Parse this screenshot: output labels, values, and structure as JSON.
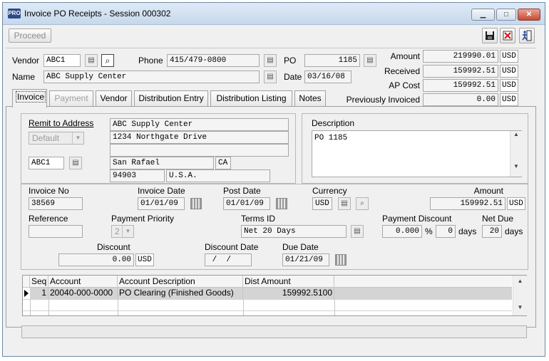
{
  "window": {
    "app_icon": "PRO",
    "title": "Invoice PO Receipts - Session 000302",
    "min_glyph": "▁",
    "max_glyph": "□",
    "close_glyph": "✕"
  },
  "toolbar": {
    "proceed_label": "Proceed",
    "save_icon": "save-icon",
    "delete_icon": "delete-icon",
    "exit_icon": "exit-icon"
  },
  "header": {
    "vendor_label": "Vendor",
    "vendor_value": "ABC1",
    "name_label": "Name",
    "name_value": "ABC Supply Center",
    "phone_label": "Phone",
    "phone_value": "415/479-0800",
    "po_label": "PO",
    "po_value": "1185",
    "date_label": "Date",
    "date_value": "03/16/08",
    "amount_label": "Amount",
    "amount_value": "219990.01",
    "received_label": "Received",
    "received_value": "159992.51",
    "ap_cost_label": "AP Cost",
    "ap_cost_value": "159992.51",
    "prev_invoiced_label": "Previously Invoiced",
    "prev_invoiced_value": "0.00",
    "currency": "USD"
  },
  "tabs": [
    {
      "label": "Invoice",
      "active": true,
      "disabled": false
    },
    {
      "label": "Payment",
      "active": false,
      "disabled": true
    },
    {
      "label": "Vendor",
      "active": false,
      "disabled": false
    },
    {
      "label": "Distribution Entry",
      "active": false,
      "disabled": false
    },
    {
      "label": "Distribution Listing",
      "active": false,
      "disabled": false
    },
    {
      "label": "Notes",
      "active": false,
      "disabled": false
    }
  ],
  "remit": {
    "label": "Remit to Address",
    "dropdown_value": "Default",
    "code": "ABC1",
    "line1": "ABC Supply Center",
    "line2": "1234 Northgate Drive",
    "line3": "",
    "city": "San Rafael",
    "state": "CA",
    "zip": "94903",
    "country": "U.S.A."
  },
  "description": {
    "label": "Description",
    "value": "PO 1185"
  },
  "invoice": {
    "invoice_no_label": "Invoice No",
    "invoice_no_value": "38569",
    "invoice_date_label": "Invoice Date",
    "invoice_date_value": "01/01/09",
    "post_date_label": "Post Date",
    "post_date_value": "01/01/09",
    "currency_label": "Currency",
    "currency_value": "USD",
    "amount_label": "Amount",
    "amount_value": "159992.51",
    "reference_label": "Reference",
    "reference_value": "",
    "payment_priority_label": "Payment Priority",
    "payment_priority_value": "2",
    "terms_label": "Terms ID",
    "terms_value": "Net 20 Days",
    "payment_discount_label": "Payment Discount",
    "payment_discount_value": "0.000",
    "pct": "%",
    "discount_days_value": "0",
    "days_label": "days",
    "net_due_label": "Net Due",
    "net_due_value": "20",
    "discount_label": "Discount",
    "discount_value": "0.00",
    "discount_date_label": "Discount Date",
    "discount_date_value": " /  /",
    "due_date_label": "Due Date",
    "due_date_value": "01/21/09"
  },
  "grid": {
    "columns": [
      "Seq",
      "Account",
      "Account Description",
      "Dist Amount"
    ],
    "rows": [
      {
        "seq": "1",
        "account": "20040-000-0000",
        "description": "PO Clearing (Finished Goods)",
        "amount": "159992.5100"
      }
    ]
  }
}
